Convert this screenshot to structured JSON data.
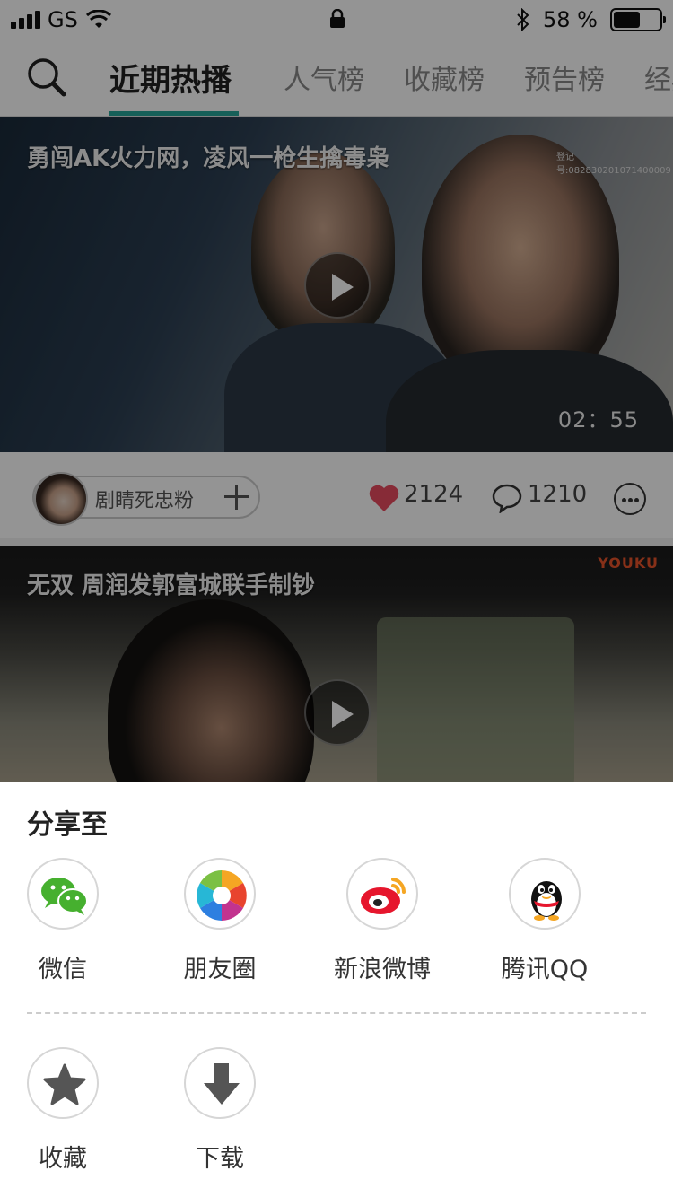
{
  "status_bar": {
    "carrier": "GS",
    "battery_percent": "58 %",
    "battery_level": 0.58
  },
  "nav": {
    "tabs": [
      {
        "label": "近期热播",
        "active": true
      },
      {
        "label": "人气榜"
      },
      {
        "label": "收藏榜"
      },
      {
        "label": "预告榜"
      },
      {
        "label": "经典"
      }
    ]
  },
  "videos": [
    {
      "title": "勇闯AK火力网，凌风一枪生擒毒枭",
      "duration": "02：55",
      "watermark": "登记号:082830201071400009",
      "author": "剧睛死忠粉",
      "likes": "2124",
      "comments": "1210"
    },
    {
      "title": "无双 周润发郭富城联手制钞",
      "brand": "YOUKU"
    }
  ],
  "share_sheet": {
    "title": "分享至",
    "targets": [
      {
        "label": "微信",
        "icon": "wechat-icon"
      },
      {
        "label": "朋友圈",
        "icon": "moments-icon"
      },
      {
        "label": "新浪微博",
        "icon": "weibo-icon"
      },
      {
        "label": "腾讯QQ",
        "icon": "qq-icon"
      }
    ],
    "actions": [
      {
        "label": "收藏",
        "icon": "star-icon"
      },
      {
        "label": "下载",
        "icon": "download-icon"
      }
    ]
  },
  "colors": {
    "accent": "#26a69a",
    "heart": "#e84a5f",
    "wechat": "#46b02f"
  }
}
